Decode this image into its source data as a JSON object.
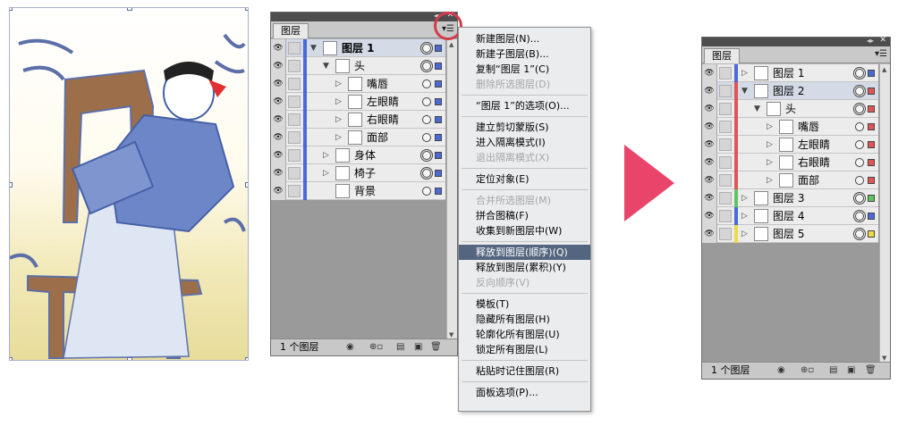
{
  "colors": {
    "panel_bg": "#b4b4b4",
    "row_bg": "#ececec",
    "selected_row": "#d4dbe6",
    "menu_highlight": "#54657f",
    "arrow": "#e9456a",
    "circle": "#d23c4c",
    "layer_blue": "#4b6ad9",
    "layer_red": "#e05555",
    "layer_green": "#5fc65f",
    "layer_yellow": "#ecdc45"
  },
  "panel1": {
    "tab": "图层",
    "footer_count": "1 个图层",
    "layers": [
      {
        "name": "图层 1",
        "bold": true,
        "expanded": true,
        "selected": true,
        "color": "#4b6ad9"
      },
      {
        "name": "头",
        "expanded": true,
        "color": "#4b6ad9"
      },
      {
        "name": "嘴唇",
        "color": "#4b6ad9"
      },
      {
        "name": "左眼睛",
        "color": "#4b6ad9"
      },
      {
        "name": "右眼睛",
        "color": "#4b6ad9"
      },
      {
        "name": "面部",
        "color": "#4b6ad9"
      },
      {
        "name": "身体",
        "color": "#4b6ad9"
      },
      {
        "name": "椅子",
        "color": "#4b6ad9"
      },
      {
        "name": "背景",
        "color": "#4b6ad9"
      }
    ]
  },
  "menu": {
    "items": [
      {
        "label": "新建图层(N)...",
        "disabled": false
      },
      {
        "label": "新建子图层(B)...",
        "disabled": false
      },
      {
        "label": "复制“图层 1”(C)",
        "disabled": false
      },
      {
        "label": "删除所选图层(D)",
        "disabled": true
      },
      {
        "label": "“图层 1”的选项(O)...",
        "disabled": false
      },
      {
        "label": "建立剪切蒙版(S)",
        "disabled": false
      },
      {
        "label": "进入隔离模式(I)",
        "disabled": false
      },
      {
        "label": "退出隔离模式(X)",
        "disabled": true
      },
      {
        "label": "定位对象(E)",
        "disabled": false
      },
      {
        "label": "合并所选图层(M)",
        "disabled": true
      },
      {
        "label": "拼合图稿(F)",
        "disabled": false
      },
      {
        "label": "收集到新图层中(W)",
        "disabled": false
      },
      {
        "label": "释放到图层(顺序)(Q)",
        "disabled": false,
        "highlighted": true
      },
      {
        "label": "释放到图层(累积)(Y)",
        "disabled": false
      },
      {
        "label": "反向顺序(V)",
        "disabled": true
      },
      {
        "label": "模板(T)",
        "disabled": false
      },
      {
        "label": "隐藏所有图层(H)",
        "disabled": false
      },
      {
        "label": "轮廓化所有图层(U)",
        "disabled": false
      },
      {
        "label": "锁定所有图层(L)",
        "disabled": false
      },
      {
        "label": "粘贴时记住图层(R)",
        "disabled": false
      },
      {
        "label": "面板选项(P)...",
        "disabled": false
      }
    ]
  },
  "panel2": {
    "tab": "图层",
    "footer_count": "1 个图层",
    "layers": [
      {
        "name": "图层 1",
        "color": "#4b6ad9"
      },
      {
        "name": "图层 2",
        "expanded": true,
        "selected": true,
        "color": "#e05555"
      },
      {
        "name": "头",
        "expanded": true,
        "color": "#e05555"
      },
      {
        "name": "嘴唇",
        "color": "#e05555"
      },
      {
        "name": "左眼睛",
        "color": "#e05555"
      },
      {
        "name": "右眼睛",
        "color": "#e05555"
      },
      {
        "name": "面部",
        "color": "#e05555"
      },
      {
        "name": "图层 3",
        "color": "#5fc65f"
      },
      {
        "name": "图层 4",
        "color": "#4b6ad9"
      },
      {
        "name": "图层 5",
        "color": "#ecdc45"
      }
    ]
  }
}
